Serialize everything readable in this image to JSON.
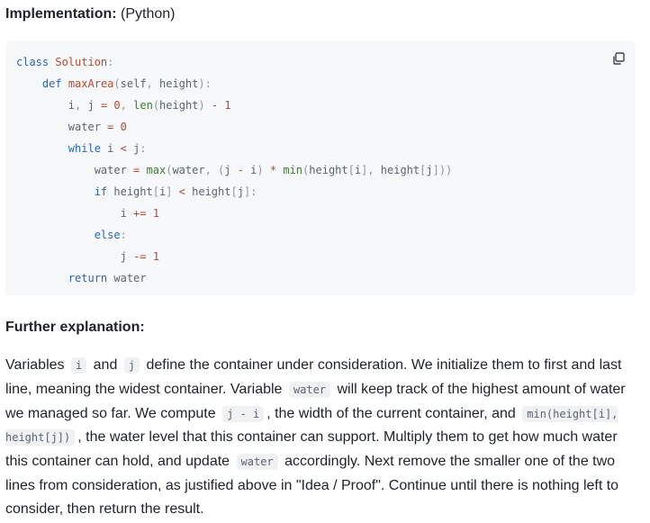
{
  "implementation": {
    "label": "Implementation:",
    "suffix": " (Python)"
  },
  "code": {
    "copy_icon": "copy-icon",
    "lines": [
      [
        [
          "kw",
          "class"
        ],
        [
          "vr",
          " "
        ],
        [
          "fn",
          "Solution"
        ],
        [
          "pu",
          ":"
        ]
      ],
      [
        [
          "vr",
          "    "
        ],
        [
          "kw",
          "def"
        ],
        [
          "vr",
          " "
        ],
        [
          "fn",
          "maxArea"
        ],
        [
          "pu",
          "("
        ],
        [
          "vr",
          "self"
        ],
        [
          "pu",
          ","
        ],
        [
          "vr",
          " height"
        ],
        [
          "pu",
          "):"
        ]
      ],
      [
        [
          "vr",
          "        i"
        ],
        [
          "pu",
          ","
        ],
        [
          "vr",
          " j "
        ],
        [
          "op",
          "="
        ],
        [
          "vr",
          " "
        ],
        [
          "num",
          "0"
        ],
        [
          "pu",
          ","
        ],
        [
          "vr",
          " "
        ],
        [
          "bi",
          "len"
        ],
        [
          "pu",
          "("
        ],
        [
          "vr",
          "height"
        ],
        [
          "pu",
          ")"
        ],
        [
          "vr",
          " "
        ],
        [
          "op",
          "-"
        ],
        [
          "vr",
          " "
        ],
        [
          "num",
          "1"
        ]
      ],
      [
        [
          "vr",
          "        water "
        ],
        [
          "op",
          "="
        ],
        [
          "vr",
          " "
        ],
        [
          "num",
          "0"
        ]
      ],
      [
        [
          "vr",
          "        "
        ],
        [
          "kw",
          "while"
        ],
        [
          "vr",
          " i "
        ],
        [
          "op",
          "<"
        ],
        [
          "vr",
          " j"
        ],
        [
          "pu",
          ":"
        ]
      ],
      [
        [
          "vr",
          "            water "
        ],
        [
          "op",
          "="
        ],
        [
          "vr",
          " "
        ],
        [
          "bi",
          "max"
        ],
        [
          "pu",
          "("
        ],
        [
          "vr",
          "water"
        ],
        [
          "pu",
          ","
        ],
        [
          "vr",
          " "
        ],
        [
          "pu",
          "("
        ],
        [
          "vr",
          "j "
        ],
        [
          "op",
          "-"
        ],
        [
          "vr",
          " i"
        ],
        [
          "pu",
          ")"
        ],
        [
          "vr",
          " "
        ],
        [
          "op",
          "*"
        ],
        [
          "vr",
          " "
        ],
        [
          "bi",
          "min"
        ],
        [
          "pu",
          "("
        ],
        [
          "vr",
          "height"
        ],
        [
          "pu",
          "["
        ],
        [
          "vr",
          "i"
        ],
        [
          "pu",
          "],"
        ],
        [
          "vr",
          " height"
        ],
        [
          "pu",
          "["
        ],
        [
          "vr",
          "j"
        ],
        [
          "pu",
          "]))"
        ]
      ],
      [
        [
          "vr",
          "            "
        ],
        [
          "kw",
          "if"
        ],
        [
          "vr",
          " height"
        ],
        [
          "pu",
          "["
        ],
        [
          "vr",
          "i"
        ],
        [
          "pu",
          "]"
        ],
        [
          "vr",
          " "
        ],
        [
          "op",
          "<"
        ],
        [
          "vr",
          " height"
        ],
        [
          "pu",
          "["
        ],
        [
          "vr",
          "j"
        ],
        [
          "pu",
          "]:"
        ]
      ],
      [
        [
          "vr",
          "                i "
        ],
        [
          "op",
          "+="
        ],
        [
          "vr",
          " "
        ],
        [
          "num",
          "1"
        ]
      ],
      [
        [
          "vr",
          "            "
        ],
        [
          "kw",
          "else"
        ],
        [
          "pu",
          ":"
        ]
      ],
      [
        [
          "vr",
          "                j "
        ],
        [
          "op",
          "-="
        ],
        [
          "vr",
          " "
        ],
        [
          "num",
          "1"
        ]
      ],
      [
        [
          "vr",
          "        "
        ],
        [
          "kw",
          "return"
        ],
        [
          "vr",
          " water"
        ]
      ]
    ]
  },
  "further": {
    "label": "Further explanation:"
  },
  "paragraph": [
    [
      "t",
      "Variables "
    ],
    [
      "c",
      "i"
    ],
    [
      "t",
      " and "
    ],
    [
      "c",
      "j"
    ],
    [
      "t",
      " define the container under consideration. We initialize them to first and last line, meaning the widest container. Variable "
    ],
    [
      "c",
      "water"
    ],
    [
      "t",
      " will keep track of the highest amount of water we managed so far. We compute "
    ],
    [
      "c",
      "j - i"
    ],
    [
      "t",
      ", the width of the current container, and "
    ],
    [
      "c",
      "min(height[i], height[j])"
    ],
    [
      "t",
      ", the water level that this container can support. Multiply them to get how much water this container can hold, and update "
    ],
    [
      "c",
      "water"
    ],
    [
      "t",
      " accordingly. Next remove the smaller one of the two lines from consideration, as justified above in \"Idea / Proof\". Continue until there is nothing left to consider, then return the result."
    ]
  ]
}
